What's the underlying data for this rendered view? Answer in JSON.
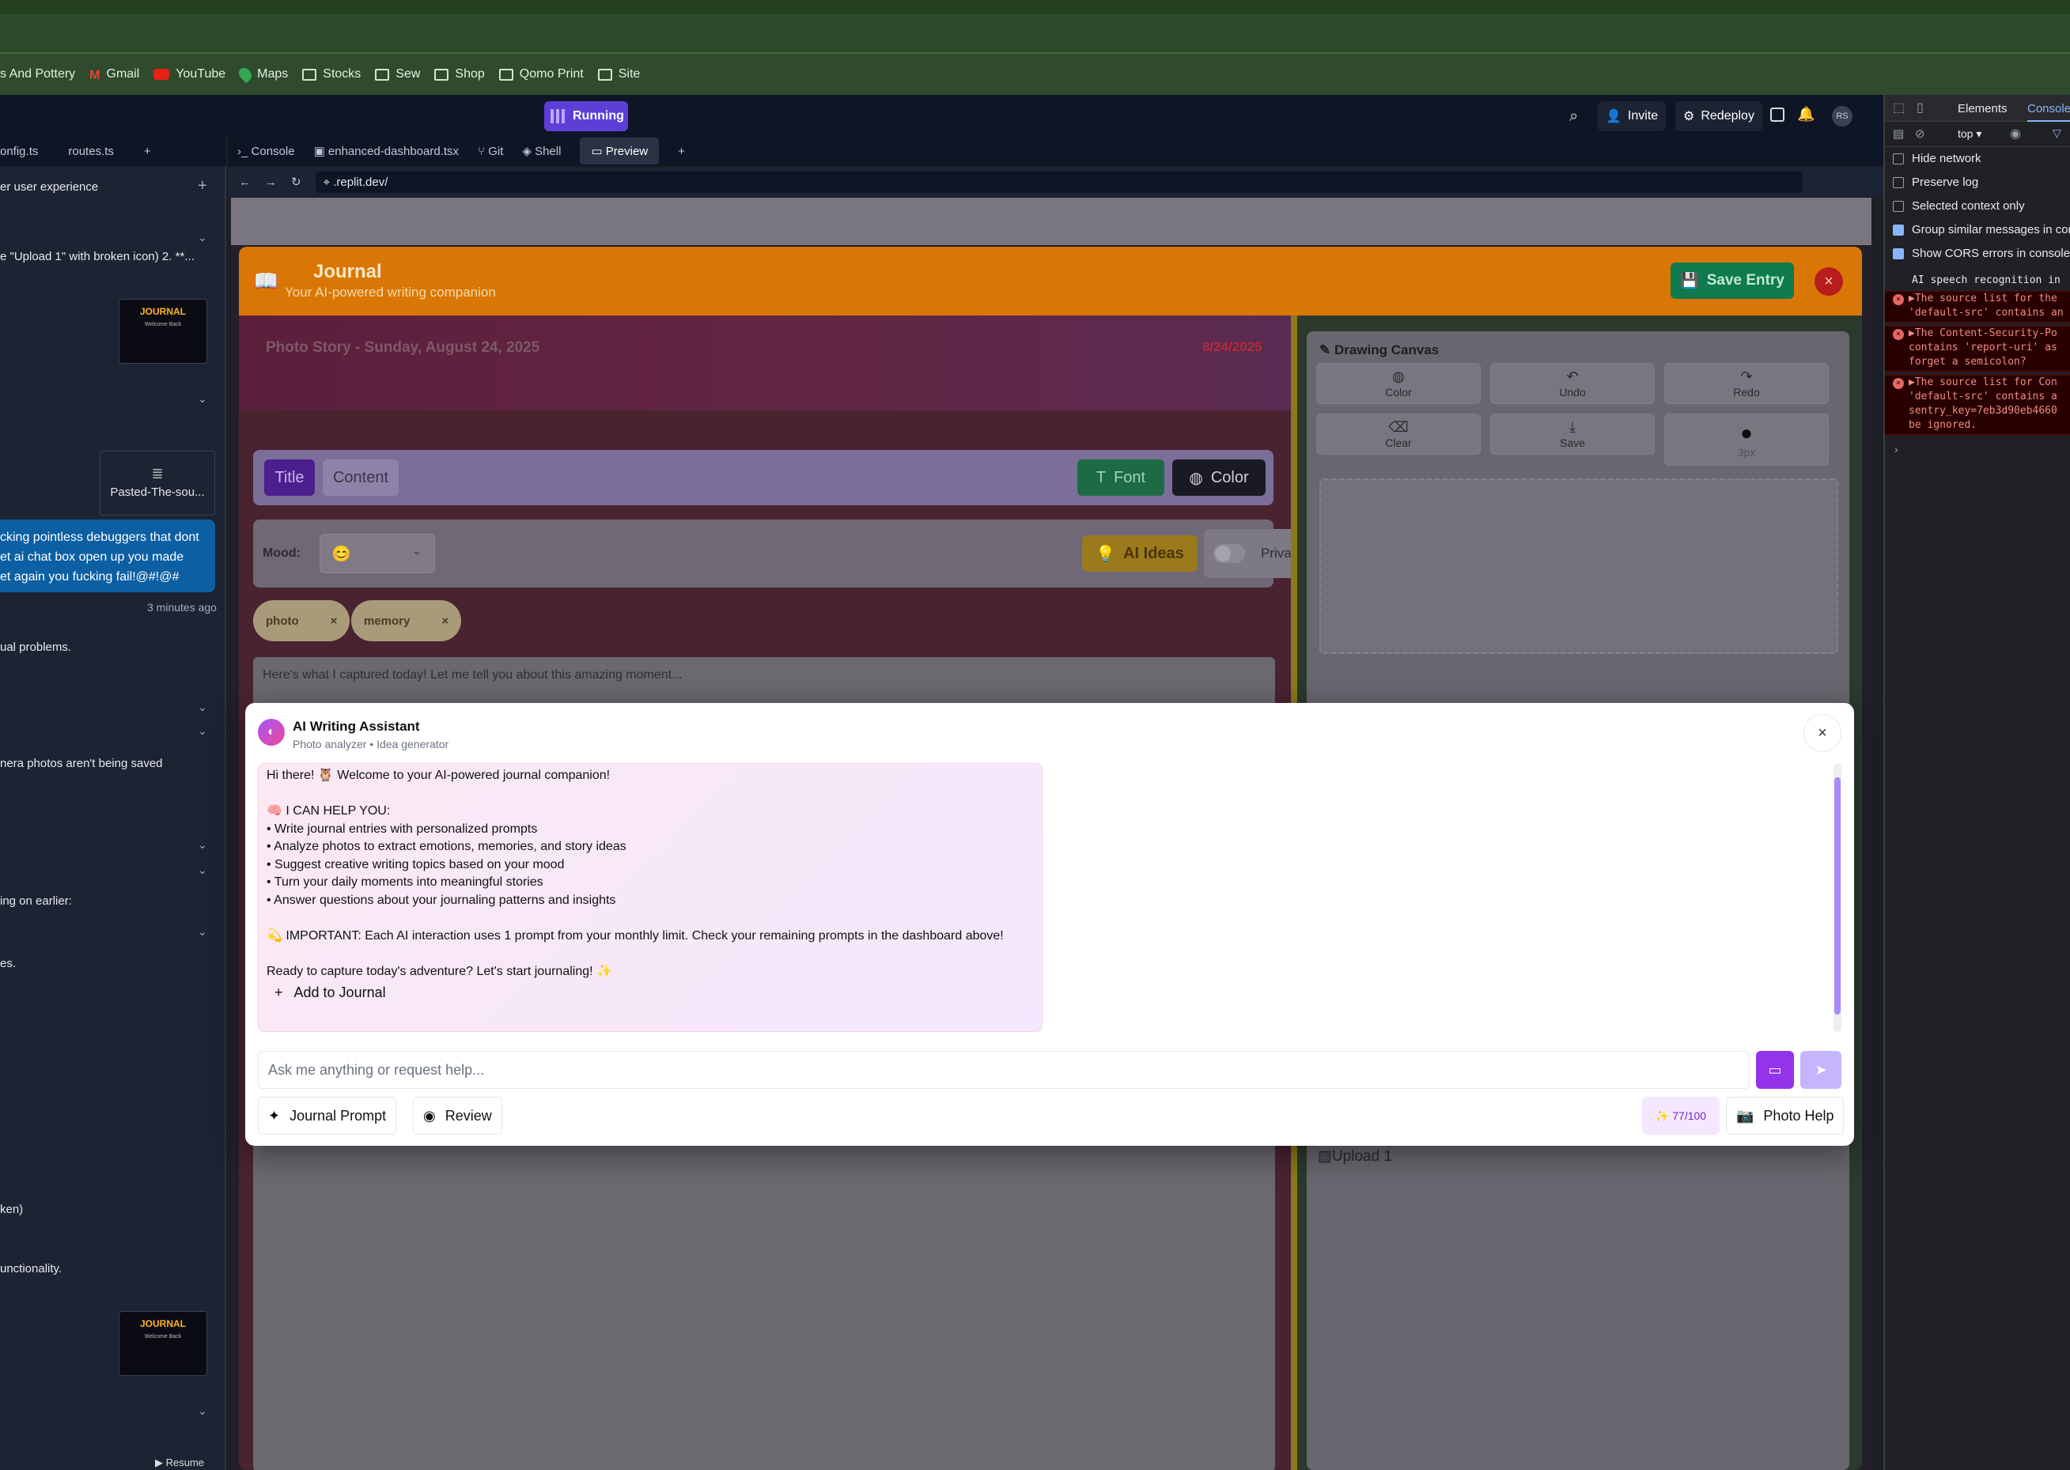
{
  "bookmarks": {
    "items": [
      "s And Pottery",
      "Gmail",
      "YouTube",
      "Maps",
      "Stocks",
      "Sew",
      "Shop",
      "Qomo Print",
      "Site"
    ]
  },
  "replit": {
    "status": "Running",
    "invite": "Invite",
    "redeploy": "Redeploy",
    "avatar": "RS"
  },
  "left_panel": {
    "tabs": [
      "onfig.ts",
      "routes.ts"
    ],
    "thread_title": "er user experience",
    "items": [
      "e \"Upload 1\" with broken icon) 2. **...",
      "Pasted-The-sou...",
      "ual problems.",
      "nera photos aren't being saved",
      "ing on earlier:",
      "es.",
      "ken)",
      "unctionality."
    ],
    "user_message": [
      "cking pointless debuggers that dont",
      "et ai chat box open up you made",
      "et again you fucking fail!@#!@#"
    ],
    "timestamp": "3 minutes ago",
    "resume": "Resume",
    "thumb_title": "JOURNAL",
    "thumb_sub": "Welcome Back"
  },
  "workspace": {
    "tabs": [
      "Console",
      "enhanced-dashboard.tsx",
      "Git",
      "Shell",
      "Preview"
    ],
    "url": ".replit.dev/"
  },
  "journal": {
    "title": "Journal",
    "subtitle": "Your AI-powered writing companion",
    "save_label": "Save Entry",
    "photo_story": "Photo Story - Sunday, August 24, 2025",
    "date_badge": "8/24/2025",
    "toolbar": {
      "title_tab": "Title",
      "content_tab": "Content",
      "font": "Font",
      "color": "Color"
    },
    "mood_label": "Mood:",
    "ai_ideas": "AI Ideas",
    "private": "Private",
    "tags": [
      "photo",
      "memory"
    ],
    "entry_text": "Here's what I captured today! Let me tell you about this amazing moment...",
    "canvas": {
      "title": "Drawing Canvas",
      "buttons": [
        "Color",
        "Undo",
        "Redo",
        "Clear",
        "Save"
      ],
      "brush_size": "3px"
    },
    "upload_alt": "Upload 1"
  },
  "assistant": {
    "title": "AI Writing Assistant",
    "subtitle": "Photo analyzer • Idea generator",
    "message": {
      "greeting": "Hi there! 🦉 Welcome to your AI-powered journal companion!",
      "help_heading": "🧠 I CAN HELP YOU:",
      "bullets": [
        "• Write journal entries with personalized prompts",
        "• Analyze photos to extract emotions, memories, and story ideas",
        "• Suggest creative writing topics based on your mood",
        "• Turn your daily moments into meaningful stories",
        "• Answer questions about your journaling patterns and insights"
      ],
      "important": "💫 IMPORTANT: Each AI interaction uses 1 prompt from your monthly limit. Check your remaining prompts in the dashboard above!",
      "closing": "Ready to capture today's adventure? Let's start journaling! ✨"
    },
    "add_to_journal": "Add to Journal",
    "input_placeholder": "Ask me anything or request help...",
    "journal_prompt": "Journal Prompt",
    "review": "Review",
    "prompt_count": "77/100",
    "photo_help": "Photo Help"
  },
  "devtools": {
    "tabs": [
      "Elements",
      "Console"
    ],
    "context": "top",
    "checks": [
      {
        "label": "Hide network",
        "checked": false
      },
      {
        "label": "Preserve log",
        "checked": false
      },
      {
        "label": "Selected context only",
        "checked": false
      },
      {
        "label": "Group similar messages in cons",
        "checked": true
      },
      {
        "label": "Show CORS errors in console",
        "checked": true
      }
    ],
    "info_line": "AI speech recognition in",
    "errors": [
      [
        "▶The source list for the",
        "'default-src' contains an"
      ],
      [
        "▶The Content-Security-Po",
        "contains 'report-uri' as",
        "forget a semicolon?"
      ],
      [
        "▶The source list for Con",
        "'default-src' contains a",
        "sentry_key=7eb3d90eb4660",
        "be ignored."
      ]
    ]
  },
  "colors": {
    "journal_header": "#d97706",
    "save_entry": "#0f7a4d",
    "assistant_accent": "#9333ea",
    "running_badge": "#5b3fd6"
  }
}
